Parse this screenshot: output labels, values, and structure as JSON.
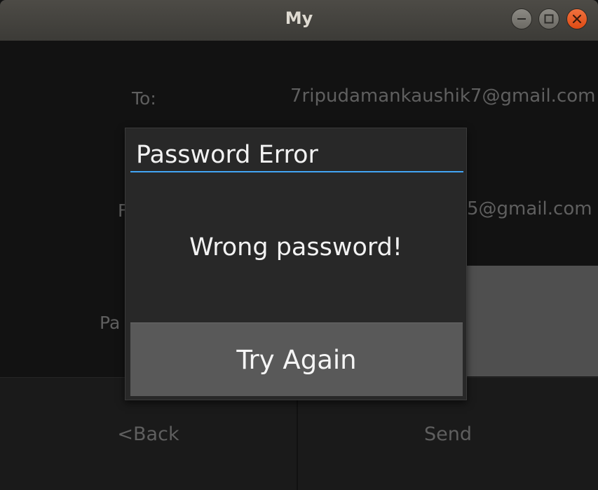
{
  "window": {
    "title": "My",
    "controls": {
      "minimize_icon": "minimize-icon",
      "maximize_icon": "maximize-icon",
      "close_icon": "close-icon"
    }
  },
  "form": {
    "to_label": "To:",
    "to_value": "7ripudamankaushik7@gmail.com",
    "from_label_partial": "F",
    "from_value_partial": "5@gmail.com",
    "password_label_partial": "Pa"
  },
  "bottom_bar": {
    "back_label": "<Back",
    "send_label": "Send"
  },
  "dialog": {
    "title": "Password Error",
    "message": "Wrong password!",
    "button_label": "Try Again",
    "accent_color": "#42a5f5"
  }
}
